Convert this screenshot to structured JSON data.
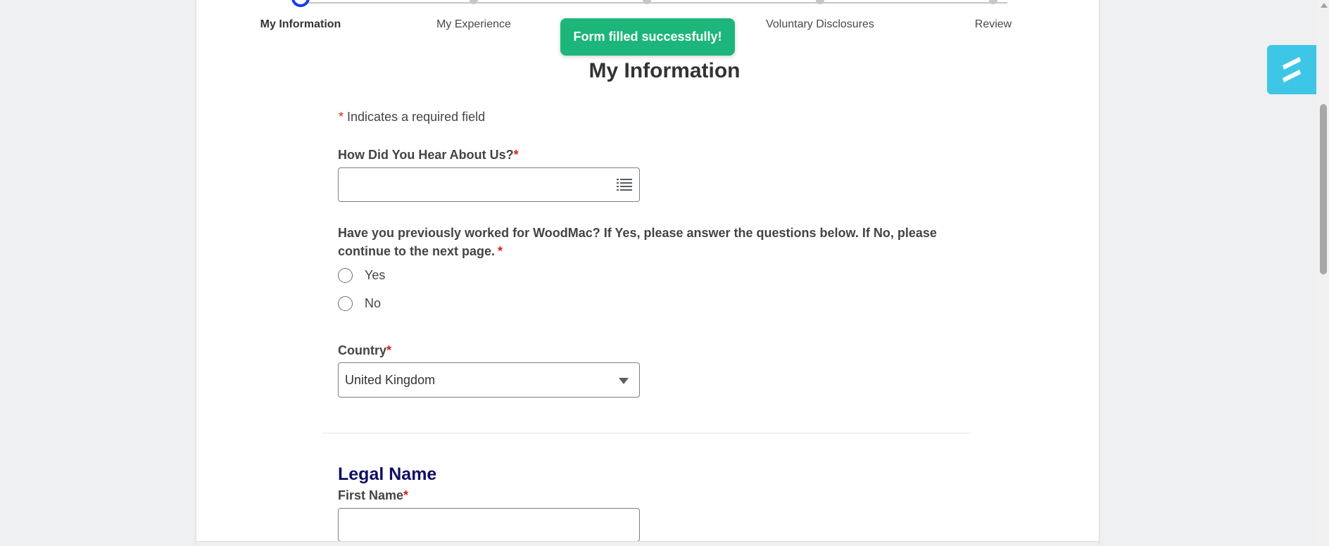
{
  "stepper": {
    "steps": [
      {
        "label": "My Information",
        "state": "active"
      },
      {
        "label": "My Experience",
        "state": "upcoming"
      },
      {
        "label": "",
        "state": "upcoming"
      },
      {
        "label": "Voluntary Disclosures",
        "state": "upcoming"
      },
      {
        "label": "Review",
        "state": "upcoming"
      }
    ]
  },
  "toast": {
    "message": "Form filled successfully!"
  },
  "page": {
    "title": "My Information"
  },
  "required_note": {
    "star": "*",
    "text": "Indicates a required field"
  },
  "hear_about": {
    "label": "How Did You Hear About Us?",
    "star": "*",
    "value": ""
  },
  "worked_before": {
    "question": "Have you previously worked for WoodMac? If Yes, please answer the questions below. If No, please continue to the next page.",
    "star": "*",
    "options": [
      "Yes",
      "No"
    ]
  },
  "country": {
    "label": "Country",
    "star": "*",
    "selected": "United Kingdom"
  },
  "legal_name": {
    "section_title": "Legal Name",
    "first_name_label": "First Name",
    "star": "*",
    "first_name_value": ""
  },
  "colors": {
    "accent": "#1a3af0",
    "toast_bg": "#1cb67a",
    "required_star": "#d0251e",
    "section_title": "#0e0f65",
    "widget_bg": "#3ec6e6"
  },
  "icons": {
    "hear_about_picker": "list-icon",
    "country_dropdown": "caret-down-icon",
    "widget": "brand-logo-icon"
  }
}
